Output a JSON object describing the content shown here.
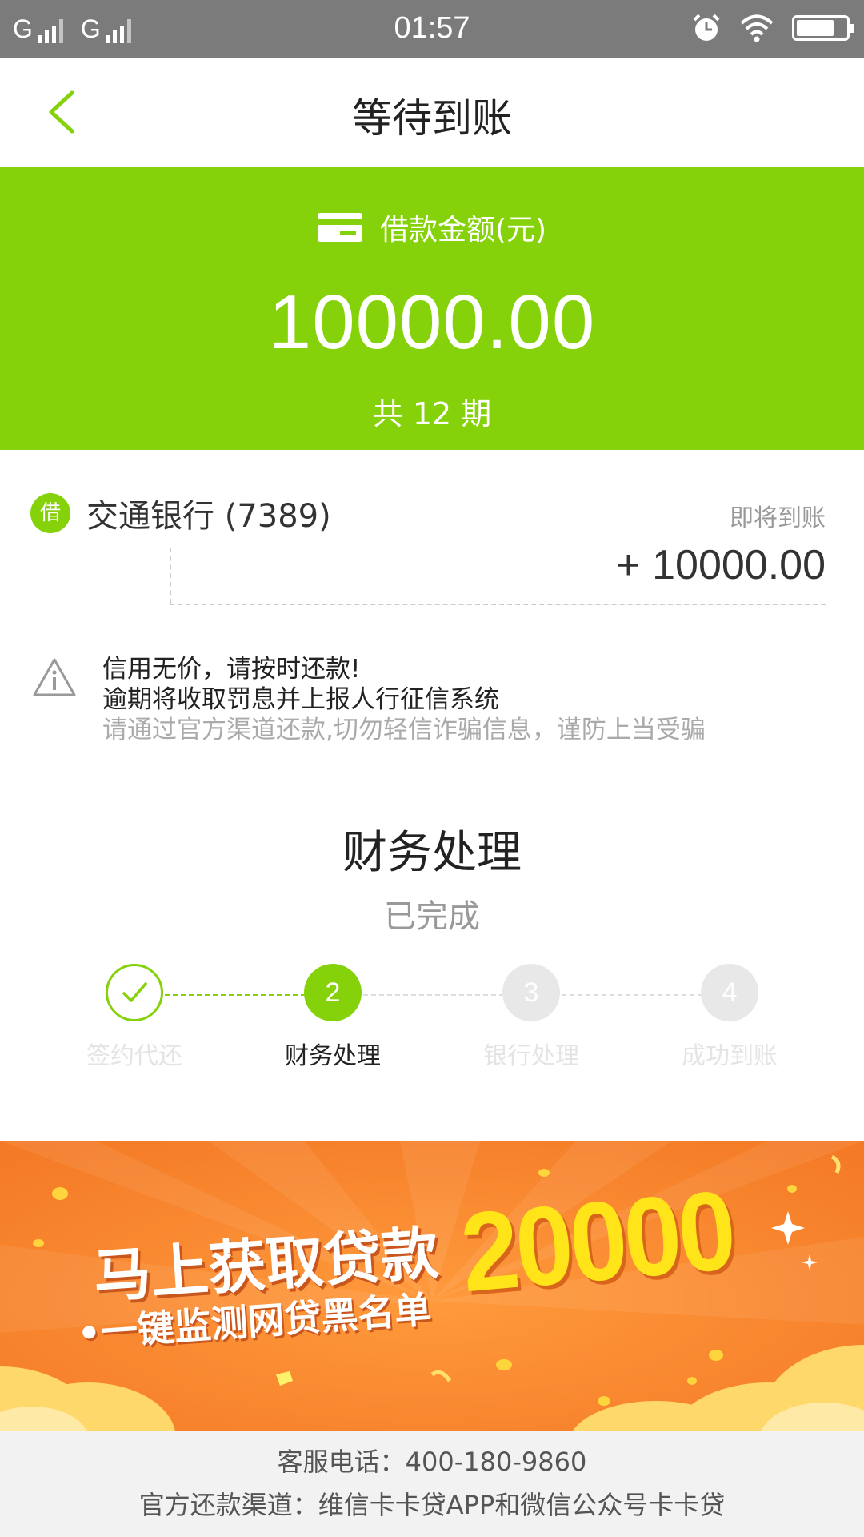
{
  "status_bar": {
    "signal1": "G",
    "signal2": "G",
    "time": "01:57"
  },
  "header": {
    "title": "等待到账"
  },
  "loan": {
    "label": "借款金额(元)",
    "amount": "10000.00",
    "periods": "共 12 期"
  },
  "bank": {
    "badge": "借",
    "name": "交通银行 (7389)",
    "status": "即将到账",
    "amount": "+ 10000.00"
  },
  "notice": {
    "line1": "信用无价，请按时还款!",
    "line2": "逾期将收取罚息并上报人行征信系统",
    "line3": "请通过官方渠道还款,切勿轻信诈骗信息，谨防上当受骗"
  },
  "progress": {
    "title": "财务处理",
    "status": "已完成",
    "steps": [
      {
        "number": "",
        "label": "签约代还",
        "state": "done"
      },
      {
        "number": "2",
        "label": "财务处理",
        "state": "active"
      },
      {
        "number": "3",
        "label": "银行处理",
        "state": "todo"
      },
      {
        "number": "4",
        "label": "成功到账",
        "state": "todo"
      }
    ]
  },
  "banner": {
    "line1": "马上获取贷款",
    "line2": "•一键监测网贷黑名单",
    "number": "20000"
  },
  "footer": {
    "phone": "客服电话：400-180-9860",
    "channel": "官方还款渠道：维信卡卡贷APP和微信公众号卡卡贷"
  },
  "colors": {
    "accent": "#86d20a",
    "banner_bg": "#f8832f",
    "banner_number": "#ffe41a"
  }
}
